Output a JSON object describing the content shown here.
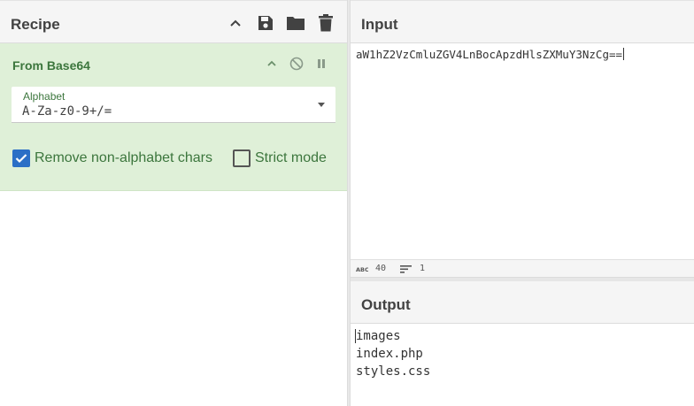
{
  "recipe": {
    "title": "Recipe",
    "icons": [
      "chevron-up-icon",
      "save-icon",
      "folder-icon",
      "trash-icon"
    ]
  },
  "operation": {
    "title": "From Base64",
    "alphabet": {
      "label": "Alphabet",
      "value": "A-Za-z0-9+/="
    },
    "options": [
      {
        "label": "Remove non-alphabet chars",
        "checked": true
      },
      {
        "label": "Strict mode",
        "checked": false
      }
    ]
  },
  "input": {
    "title": "Input",
    "text": "aW1hZ2VzCmluZGV4LnBocApzdHlsZXMuY3NzCg==",
    "status": {
      "chars": "40",
      "lines": "1"
    }
  },
  "output": {
    "title": "Output",
    "lines": [
      "images",
      "index.php",
      "styles.css"
    ]
  },
  "colors": {
    "operation_bg": "#dff0d8",
    "operation_text": "#3c763d",
    "checkbox_accent": "#2b6fc6"
  }
}
